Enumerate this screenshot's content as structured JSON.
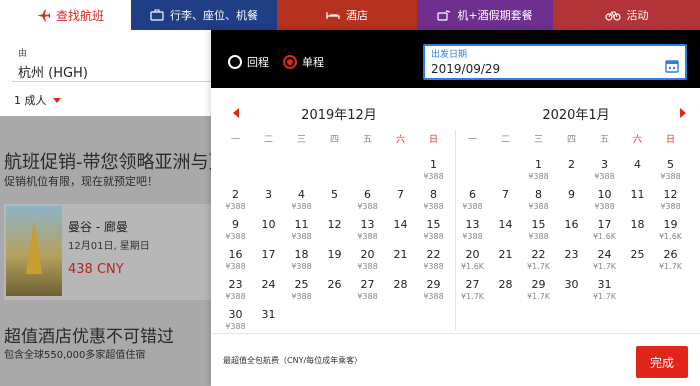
{
  "tabs": {
    "flights": "查找航班",
    "bundle": "行李、座位、机餐",
    "hotel": "酒店",
    "hotel_flight": "机+酒假期套餐",
    "activities": "活动"
  },
  "search": {
    "from_label": "由",
    "from_value": "杭州 (HGH)",
    "passengers": "1 成人"
  },
  "promo": {
    "title": "航班促销-带您领略亚洲与更",
    "subtitle": "促销机位有限，现在就预定吧！",
    "deal": {
      "route": "曼谷 - 廊曼",
      "date": "12月01日, 星期日",
      "price": "438 CNY"
    },
    "hotel_title": "超值酒店优惠不可错过",
    "hotel_subtitle": "包含全球550,000多家超值住宿"
  },
  "picker": {
    "trip_type": {
      "return": "回程",
      "oneway": "单程",
      "selected": "oneway"
    },
    "depart_label": "出发日期",
    "depart_value": "2019/09/29",
    "weekdays": [
      "一",
      "二",
      "三",
      "四",
      "五",
      "六",
      "日"
    ],
    "months": [
      {
        "title": "2019年12月",
        "offset": 6,
        "days": [
          {
            "d": "1",
            "p": "¥388"
          },
          {
            "d": "2",
            "p": "¥388"
          },
          {
            "d": "3",
            "p": ""
          },
          {
            "d": "4",
            "p": "¥388"
          },
          {
            "d": "5",
            "p": ""
          },
          {
            "d": "6",
            "p": "¥388"
          },
          {
            "d": "7",
            "p": ""
          },
          {
            "d": "8",
            "p": "¥388"
          },
          {
            "d": "9",
            "p": "¥388"
          },
          {
            "d": "10",
            "p": ""
          },
          {
            "d": "11",
            "p": "¥388"
          },
          {
            "d": "12",
            "p": ""
          },
          {
            "d": "13",
            "p": "¥388"
          },
          {
            "d": "14",
            "p": ""
          },
          {
            "d": "15",
            "p": "¥388"
          },
          {
            "d": "16",
            "p": "¥388"
          },
          {
            "d": "17",
            "p": ""
          },
          {
            "d": "18",
            "p": "¥388"
          },
          {
            "d": "19",
            "p": ""
          },
          {
            "d": "20",
            "p": "¥388"
          },
          {
            "d": "21",
            "p": ""
          },
          {
            "d": "22",
            "p": "¥388"
          },
          {
            "d": "23",
            "p": "¥388"
          },
          {
            "d": "24",
            "p": ""
          },
          {
            "d": "25",
            "p": "¥388"
          },
          {
            "d": "26",
            "p": ""
          },
          {
            "d": "27",
            "p": "¥388"
          },
          {
            "d": "28",
            "p": ""
          },
          {
            "d": "29",
            "p": "¥388"
          },
          {
            "d": "30",
            "p": "¥388"
          },
          {
            "d": "31",
            "p": ""
          }
        ]
      },
      {
        "title": "2020年1月",
        "offset": 2,
        "days": [
          {
            "d": "1",
            "p": "¥388"
          },
          {
            "d": "2",
            "p": ""
          },
          {
            "d": "3",
            "p": "¥388"
          },
          {
            "d": "4",
            "p": ""
          },
          {
            "d": "5",
            "p": "¥388"
          },
          {
            "d": "6",
            "p": "¥388"
          },
          {
            "d": "7",
            "p": ""
          },
          {
            "d": "8",
            "p": "¥388"
          },
          {
            "d": "9",
            "p": ""
          },
          {
            "d": "10",
            "p": "¥388"
          },
          {
            "d": "11",
            "p": ""
          },
          {
            "d": "12",
            "p": "¥388"
          },
          {
            "d": "13",
            "p": "¥388"
          },
          {
            "d": "14",
            "p": ""
          },
          {
            "d": "15",
            "p": "¥388"
          },
          {
            "d": "16",
            "p": ""
          },
          {
            "d": "17",
            "p": "¥1.6K"
          },
          {
            "d": "18",
            "p": ""
          },
          {
            "d": "19",
            "p": "¥1.6K"
          },
          {
            "d": "20",
            "p": "¥1.6K"
          },
          {
            "d": "21",
            "p": ""
          },
          {
            "d": "22",
            "p": "¥1.7K"
          },
          {
            "d": "23",
            "p": ""
          },
          {
            "d": "24",
            "p": "¥1.7K"
          },
          {
            "d": "25",
            "p": ""
          },
          {
            "d": "26",
            "p": "¥1.7K"
          },
          {
            "d": "27",
            "p": "¥1.7K"
          },
          {
            "d": "28",
            "p": ""
          },
          {
            "d": "29",
            "p": "¥1.7K"
          },
          {
            "d": "30",
            "p": ""
          },
          {
            "d": "31",
            "p": "¥1.7K"
          }
        ]
      }
    ],
    "footer_note": "最超值全包航费（CNY/每位成年乘客）",
    "done_label": "完成"
  }
}
